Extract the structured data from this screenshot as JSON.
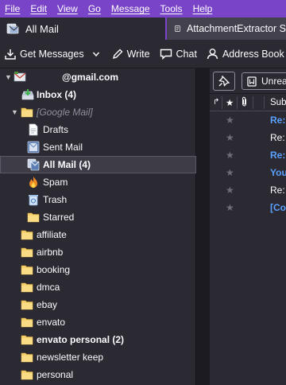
{
  "menubar": {
    "items": [
      "File",
      "Edit",
      "View",
      "Go",
      "Message",
      "Tools",
      "Help"
    ]
  },
  "tabs": {
    "active_label": "All Mail",
    "other_label": "AttachmentExtractor S"
  },
  "toolbar": {
    "get_messages": "Get Messages",
    "write": "Write",
    "chat": "Chat",
    "address_book": "Address Book"
  },
  "folders": {
    "account": "@gmail.com",
    "inbox": "Inbox (4)",
    "google_mail": "[Google Mail]",
    "drafts": "Drafts",
    "sent_mail": "Sent Mail",
    "all_mail": "All Mail (4)",
    "spam": "Spam",
    "trash": "Trash",
    "starred": "Starred",
    "affiliate": "affiliate",
    "airbnb": "airbnb",
    "booking": "booking",
    "dmca": "dmca",
    "ebay": "ebay",
    "envato": "envato",
    "envato_personal": "envato personal (2)",
    "newsletter_keep": "newsletter keep",
    "personal": "personal"
  },
  "message_pane": {
    "quick_filter_unread": "Unread",
    "subject_header": "Subject",
    "messages": [
      {
        "subject": "Re:",
        "unread": true
      },
      {
        "subject": "Re:",
        "unread": false
      },
      {
        "subject": "Re:",
        "unread": true
      },
      {
        "subject": "You",
        "unread": true
      },
      {
        "subject": "Re:",
        "unread": false
      },
      {
        "subject": "[Co",
        "unread": true
      }
    ]
  },
  "colors": {
    "accent_purple": "#7a44c8",
    "background": "#2b2a33",
    "folder_yellow": "#f6d06a",
    "unread_blue": "#5aa0ff"
  }
}
